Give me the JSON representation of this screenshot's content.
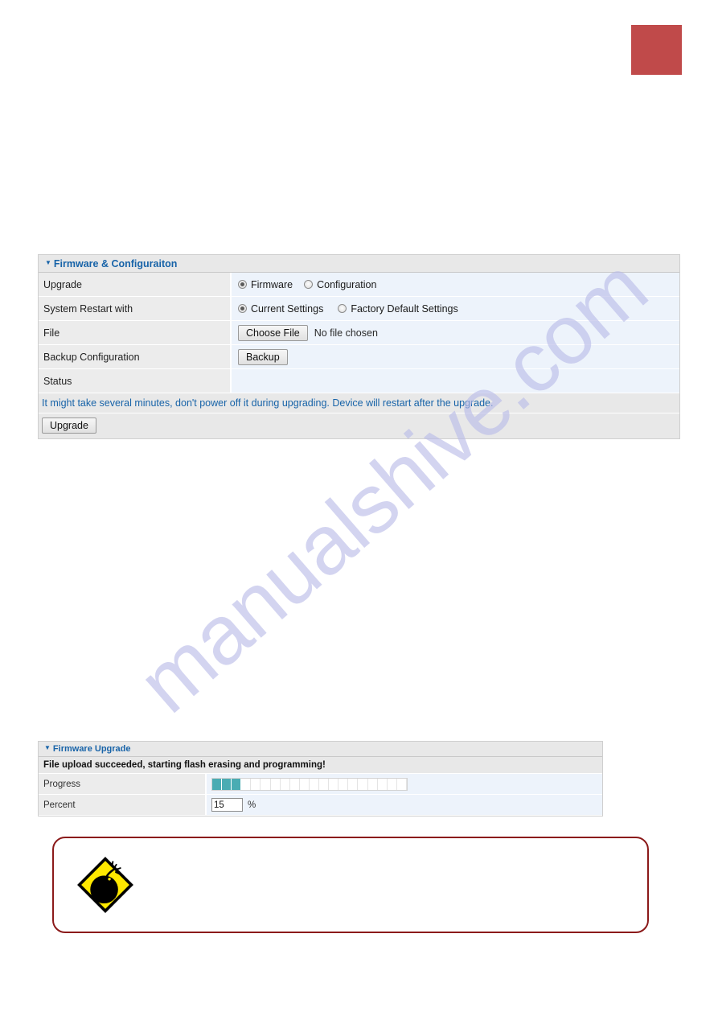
{
  "page": {
    "watermark": "manualshive.com",
    "accent_red": "#c04a4a",
    "header_blue": "#1763a8",
    "progress_teal": "#4aacb3",
    "warning_border": "#8b1a1a"
  },
  "firmware_panel": {
    "title": "Firmware & Configuraiton",
    "rows": [
      {
        "label": "Upgrade",
        "type": "radio",
        "options": [
          {
            "label": "Firmware",
            "checked": true
          },
          {
            "label": "Configuration",
            "checked": false
          }
        ]
      },
      {
        "label": "System Restart with",
        "type": "radio",
        "options": [
          {
            "label": "Current Settings",
            "checked": true
          },
          {
            "label": "Factory Default Settings",
            "checked": false
          }
        ]
      },
      {
        "label": "File",
        "type": "file",
        "button_label": "Choose File",
        "file_status": "No file chosen"
      },
      {
        "label": "Backup Configuration",
        "type": "button",
        "button_label": "Backup"
      },
      {
        "label": "Status",
        "type": "empty",
        "value": ""
      }
    ],
    "note": "It might take several minutes, don't power off it during upgrading. Device will restart after the upgrade.",
    "upgrade_button": "Upgrade"
  },
  "upgrade_panel": {
    "title": "Firmware Upgrade",
    "status_message": "File upload succeeded, starting flash erasing and programming!",
    "progress_label": "Progress",
    "progress_segments_total": 20,
    "progress_segments_filled": 3,
    "percent_label": "Percent",
    "percent_value": "15",
    "percent_sign": "%"
  },
  "warning": {
    "icon": "bomb-warning-icon",
    "text": ""
  }
}
